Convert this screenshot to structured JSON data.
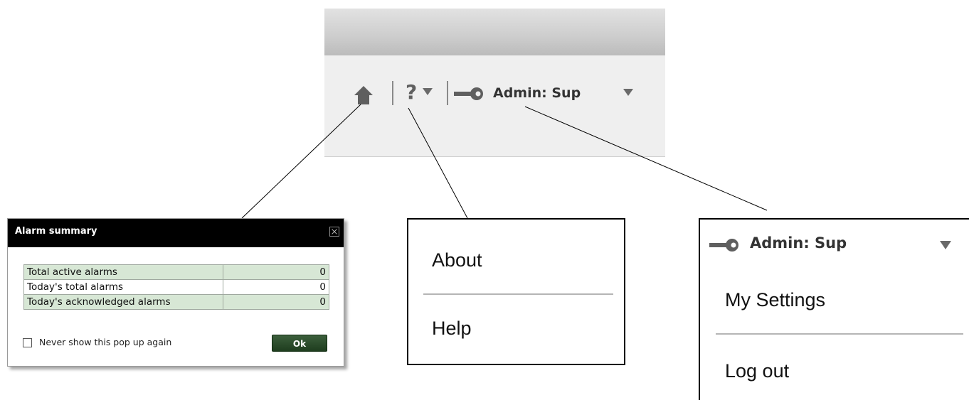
{
  "header": {
    "home_icon": "home-icon",
    "help_symbol": "?",
    "help_caret_icon": "caret-down-icon",
    "key_icon": "key-icon",
    "user_label": "Admin: Sup",
    "user_caret_icon": "caret-down-icon"
  },
  "alarm_summary": {
    "title": "Alarm summary",
    "close_icon": "close-icon",
    "rows": [
      {
        "label": "Total active alarms",
        "value": "0"
      },
      {
        "label": "Today's total alarms",
        "value": "0"
      },
      {
        "label": "Today's acknowledged alarms",
        "value": "0"
      }
    ],
    "checkbox_label": "Never show this pop up again",
    "ok_label": "Ok"
  },
  "help_menu": {
    "items": [
      {
        "label": "About"
      },
      {
        "label": "Help"
      }
    ]
  },
  "user_menu": {
    "user_label": "Admin: Sup",
    "items": [
      {
        "label": "My Settings"
      },
      {
        "label": "Log out"
      }
    ]
  },
  "colors": {
    "header_gradient_top": "#e2e2e2",
    "header_gradient_bottom": "#bbbbbb",
    "toolbar_bg": "#efefef",
    "icon_gray": "#5f5f5f",
    "dialog_titlebar": "#000000",
    "shaded_row": "#d7e7d5",
    "ok_button": "#2b4a2b"
  }
}
